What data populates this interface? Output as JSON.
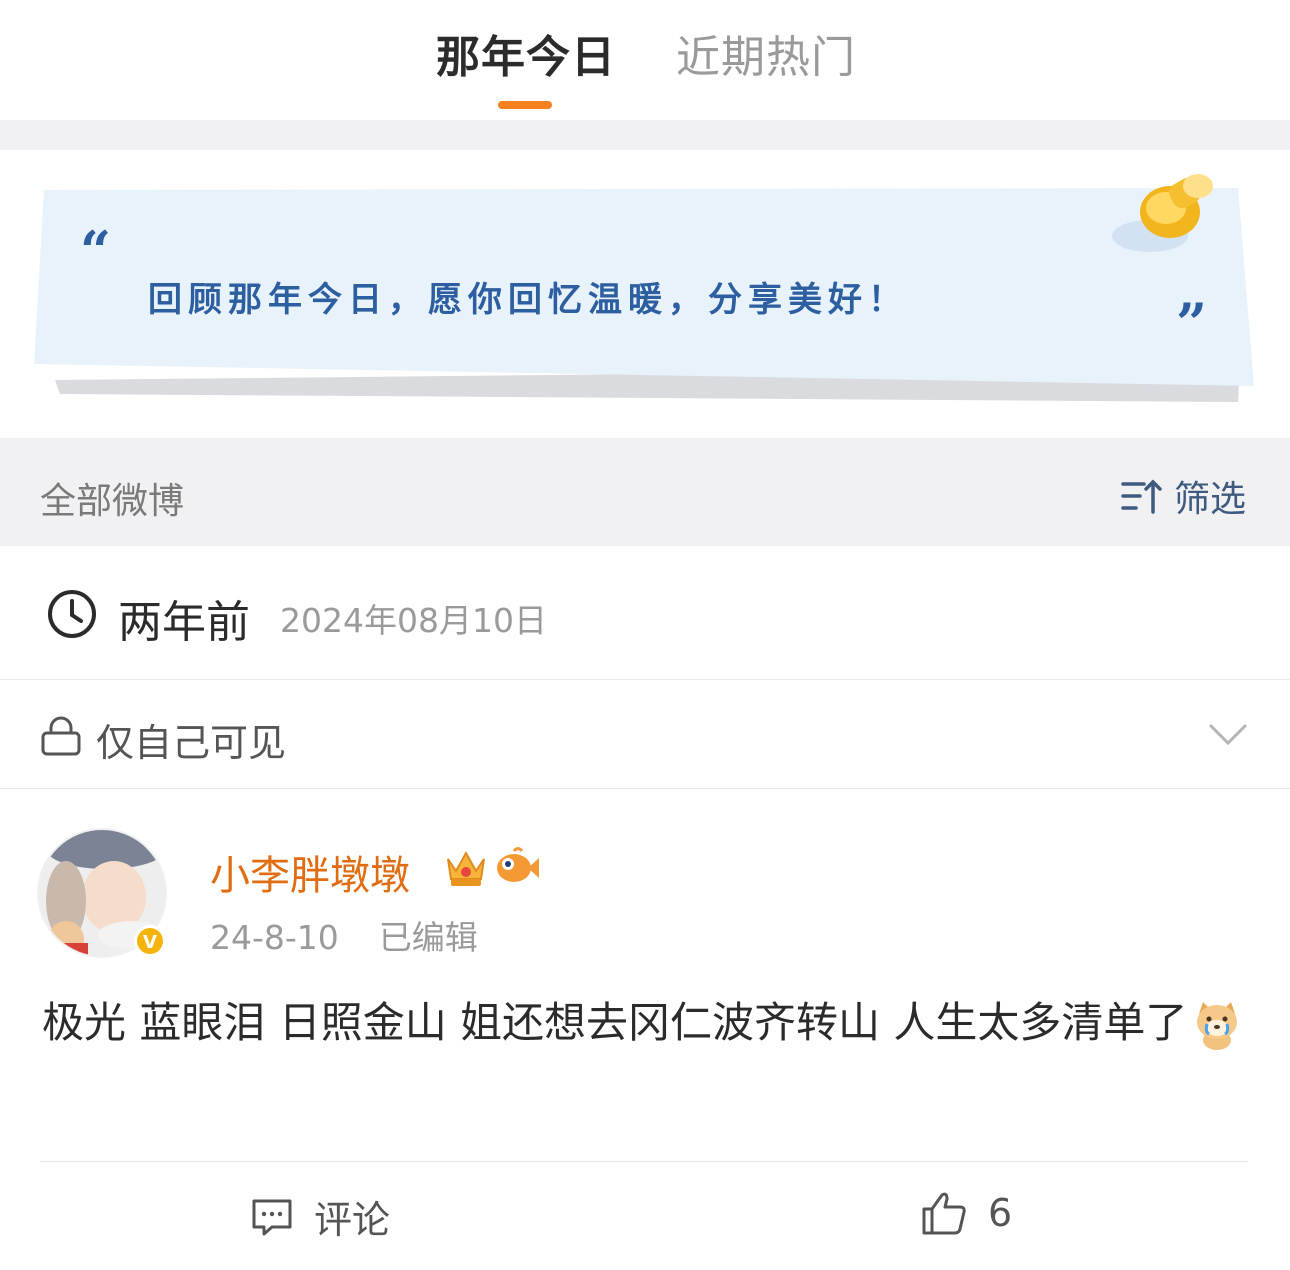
{
  "tabs": {
    "active": "那年今日",
    "inactive": "近期热门"
  },
  "banner": {
    "slogan": "回顾那年今日，愿你回忆温暖，分享美好！"
  },
  "filter_bar": {
    "title": "全部微博",
    "filter_label": "筛选"
  },
  "time_row": {
    "ago": "两年前",
    "date": "2024年08月10日"
  },
  "visibility": {
    "label": "仅自己可见"
  },
  "post": {
    "username": "小李胖墩墩",
    "time": "24-8-10",
    "edited": "已编辑",
    "text": "极光 蓝眼泪 日照金山 姐还想去冈仁波齐转山 人生太多清单了",
    "comment_label": "评论",
    "like_count": "6"
  },
  "colors": {
    "accent": "#f3811f",
    "username": "#e06d12",
    "slogan": "#2d5ea0",
    "filter": "#3f5a7f"
  }
}
